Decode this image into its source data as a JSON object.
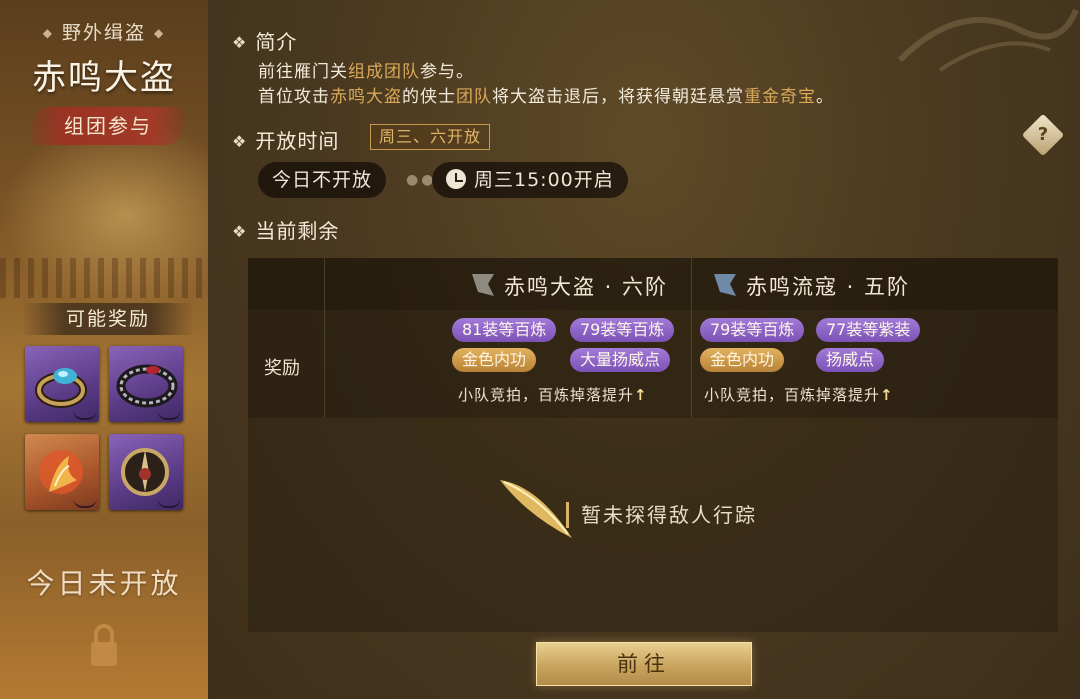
{
  "left": {
    "category": "野外缉盗",
    "boss_name": "赤鸣大盗",
    "party_tag": "组团参与",
    "rewards_header": "可能奖励",
    "reward_items": [
      {
        "icon": "ring-gem-icon",
        "rarity": "purple"
      },
      {
        "icon": "ring-bracelet-icon",
        "rarity": "purple"
      },
      {
        "icon": "flame-spirit-icon",
        "rarity": "orange"
      },
      {
        "icon": "crest-emblem-icon",
        "rarity": "purple"
      }
    ],
    "status": "今日未开放"
  },
  "intro": {
    "title": "简介",
    "line1": {
      "a": "前往雁门关",
      "b": "组成团队",
      "c": "参与。"
    },
    "line2": {
      "a": "首位攻击",
      "b": "赤鸣大盗",
      "c": "的侠士",
      "d": "团队",
      "e": "将大盗击退后，将获得朝廷悬赏",
      "f": "重金奇宝",
      "g": "。"
    }
  },
  "open_time": {
    "title": "开放时间",
    "badge": "周三、六开放",
    "today": "今日不开放",
    "next": "周三15:00开启"
  },
  "remaining": {
    "title": "当前剩余",
    "row_label": "奖励",
    "columns": [
      {
        "title": "赤鸣大盗 · 六阶",
        "tags_row1": [
          "81装等百炼",
          "79装等百炼"
        ],
        "tags_row2": [
          "金色内功",
          "大量扬威点"
        ],
        "note": "小队竞拍，百炼掉落提升"
      },
      {
        "title": "赤鸣流寇 · 五阶",
        "tags_row1": [
          "79装等百炼",
          "77装等紫装"
        ],
        "tags_row2": [
          "金色内功",
          "扬威点"
        ],
        "note": "小队竞拍，百炼掉落提升"
      }
    ],
    "empty_message": "暂未探得敌人行踪"
  },
  "go_button": "前往",
  "colors": {
    "accent_gold": "#d9a95a",
    "tag_purple": "#8f66c6",
    "tag_gold": "#cf9b4a"
  }
}
